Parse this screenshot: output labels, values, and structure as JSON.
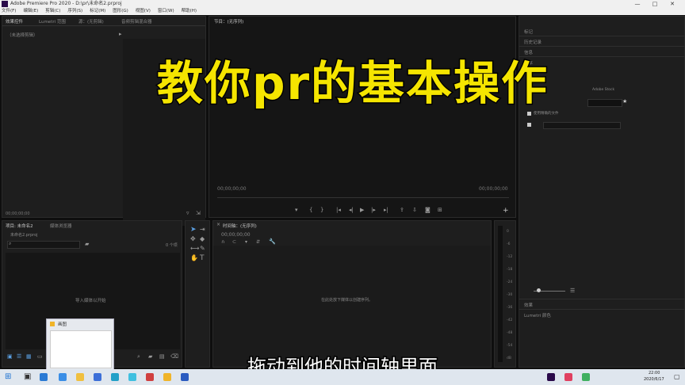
{
  "window": {
    "title": "Adobe Premiere Pro 2020 - D:\\pr\\未命名2.prproj",
    "min": "—",
    "max": "□",
    "close": "✕"
  },
  "menu": [
    "文件(F)",
    "编辑(E)",
    "剪辑(C)",
    "序列(S)",
    "标记(M)",
    "图形(G)",
    "视图(V)",
    "窗口(W)",
    "帮助(H)"
  ],
  "source_panel": {
    "tabs": [
      "效果控件",
      "Lumetri 范围",
      "源：(无剪辑)",
      "音频剪辑混合器"
    ],
    "no_clip": "（未选择剪辑）",
    "timecode": "00;00;00;00"
  },
  "program_panel": {
    "title": "节目：(无序列)",
    "tc_left": "00;00;00;00",
    "tc_right": "00;00;00;00"
  },
  "right_panel": {
    "items": [
      "标记",
      "历史记录",
      "信息",
      "基本"
    ],
    "bottom_items": [
      "效果",
      "Lumetri 颜色"
    ],
    "field1": "Adobe Stock",
    "check1": "使用精确的文件"
  },
  "project_panel": {
    "tabs": [
      "项目: 未命名2",
      "媒体浏览器"
    ],
    "file": "未命名2.prproj",
    "count": "0 个项",
    "empty_text": "导入媒体以开始"
  },
  "timeline_panel": {
    "title": "时间轴：(无序列)",
    "timecode": "00;00;00;00",
    "empty_text": "在此处放下媒体以创建序列。"
  },
  "meter_labels": [
    "0",
    "-6",
    "-12",
    "-18",
    "-24",
    "-30",
    "-36",
    "-42",
    "-48",
    "-54",
    "dB"
  ],
  "popup": {
    "title": "画图"
  },
  "overlay_title": "教你pr的基本操作",
  "subtitle": "拖动到他的时间轴里面",
  "taskbar": {
    "time": "22:00",
    "date": "2020/6/17"
  }
}
